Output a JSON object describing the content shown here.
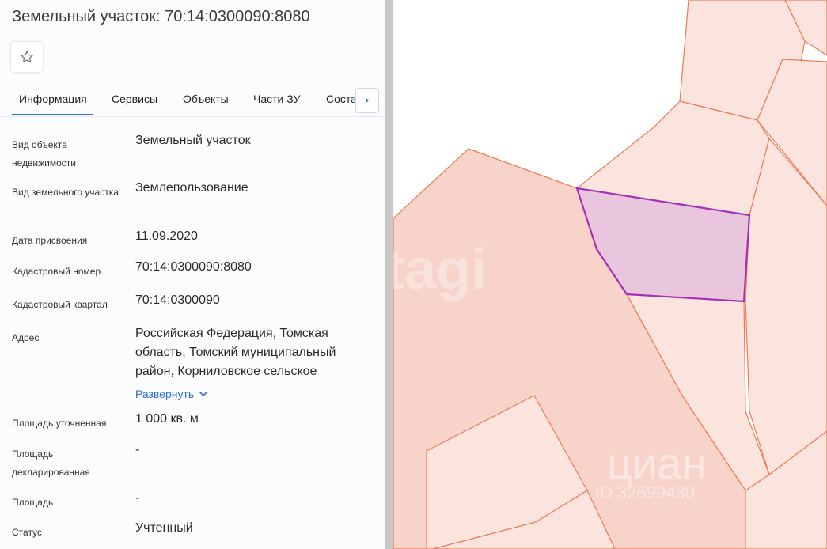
{
  "header": {
    "title": "Земельный участок: 70:14:0300090:8080"
  },
  "favorite": {
    "icon": "star-outline-icon"
  },
  "tabs": [
    {
      "label": "Информация",
      "active": true
    },
    {
      "label": "Сервисы"
    },
    {
      "label": "Объекты"
    },
    {
      "label": "Части ЗУ"
    },
    {
      "label": "Соста"
    }
  ],
  "tab_scroll_icon": "chevron-right-icon",
  "fields": {
    "type": {
      "label": "Вид объекта недвижимости",
      "value": "Земельный участок"
    },
    "land_type": {
      "label": "Вид земельного участка",
      "value": "Землепользование"
    },
    "date": {
      "label": "Дата присвоения",
      "value": "11.09.2020"
    },
    "cadastral_number": {
      "label": "Кадастровый номер",
      "value": "70:14:0300090:8080"
    },
    "cadastral_quarter": {
      "label": "Кадастровый квартал",
      "value": "70:14:0300090"
    },
    "address": {
      "label": "Адрес",
      "value": "Российская Федерация, Томская область, Томский муниципальный район, Корниловское сельское",
      "expand": "Развернуть"
    },
    "area_specified": {
      "label": "Площадь уточненная",
      "value": "1 000 кв. м"
    },
    "area_declared": {
      "label": "Площадь декларированная",
      "value": "-"
    },
    "area": {
      "label": "Площадь",
      "value": "-"
    },
    "status": {
      "label": "Статус",
      "value": "Учтенный"
    }
  },
  "map": {
    "parcel_fill": "#fbe4de",
    "parcel_stroke": "#ee7a55",
    "selected_fill": "#e9c6de",
    "selected_stroke": "#a72fb2",
    "watermarks": [
      "tagi",
      "циан",
      "ID 32699430"
    ]
  }
}
